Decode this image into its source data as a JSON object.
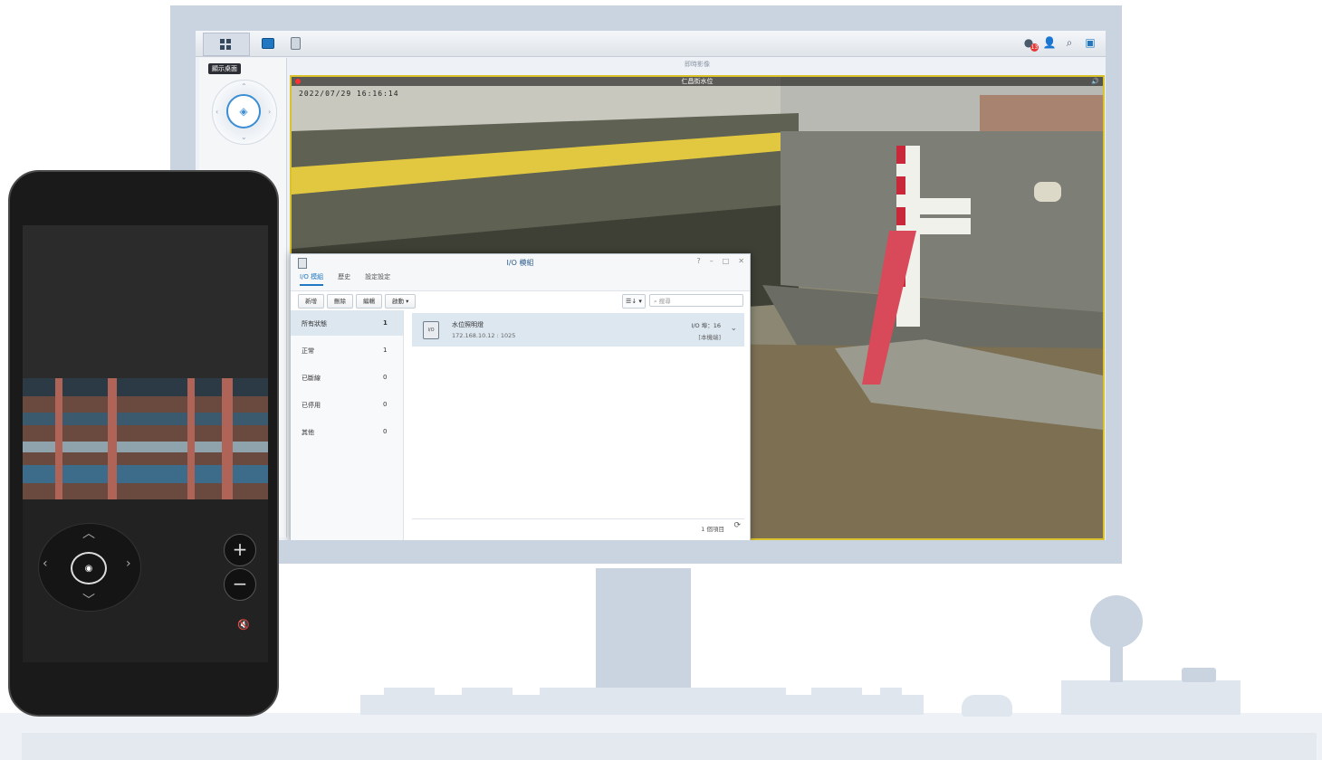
{
  "taskbar": {
    "tooltip": "顯示桌面",
    "tray_badge": "13"
  },
  "live_view": {
    "window_title": "即時影像",
    "camera_title": "仁昌街水位",
    "osd_text": "2022/07/29 16:16:14"
  },
  "io_window": {
    "title": "I/O 模組",
    "tabs": [
      {
        "label": "I/O 模組"
      },
      {
        "label": "歷史"
      },
      {
        "label": "設定設定"
      }
    ],
    "toolbar": {
      "add": "新增",
      "delete": "刪除",
      "edit": "編輯",
      "action": "啟動 ▾",
      "view": "☰↓ ▾",
      "search_placeholder": "搜尋"
    },
    "sidebar": [
      {
        "label": "所有狀態",
        "count": "1"
      },
      {
        "label": "正常",
        "count": "1"
      },
      {
        "label": "已斷線",
        "count": "0"
      },
      {
        "label": "已停用",
        "count": "0"
      },
      {
        "label": "其他",
        "count": "0"
      }
    ],
    "device": {
      "name": "水位照明燈",
      "address": "172.168.10.12 : 1025",
      "port_info": "I/O 埠：16",
      "status": "[本機端]"
    },
    "footer": {
      "count": "1 個項目"
    }
  },
  "colors": {
    "accent": "#1f78c1",
    "camera_border": "#d9c22b"
  }
}
